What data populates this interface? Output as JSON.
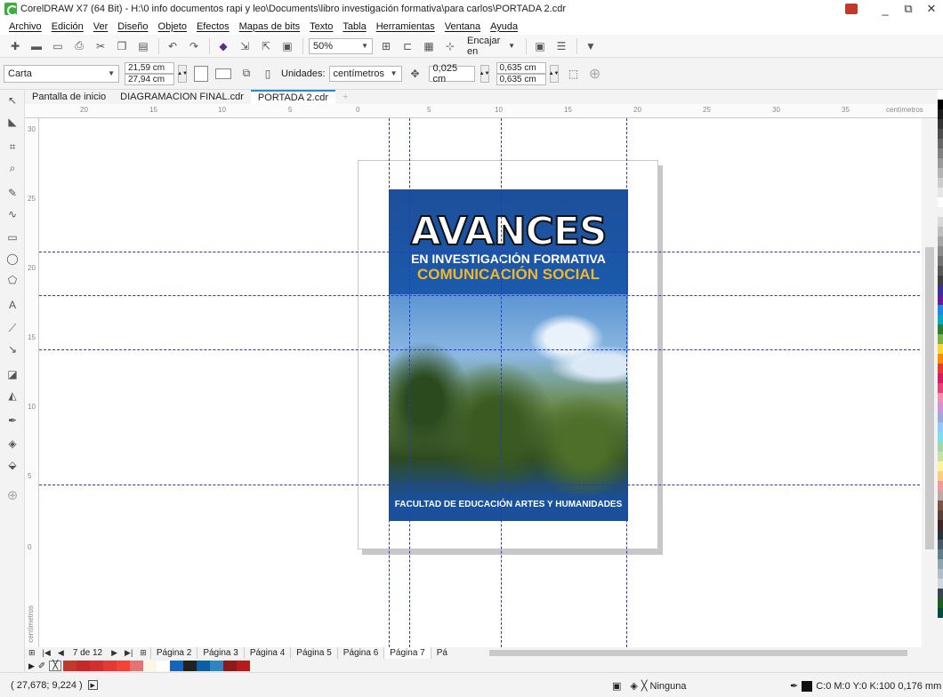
{
  "window": {
    "title": "CorelDRAW X7 (64 Bit) - H:\\0 info documentos rapi y leo\\Documents\\libro investigación formativa\\para carlos\\PORTADA 2.cdr",
    "controls": [
      "_",
      "⧉",
      "✕"
    ]
  },
  "menu": [
    "Archivo",
    "Edición",
    "Ver",
    "Diseño",
    "Objeto",
    "Efectos",
    "Mapas de bits",
    "Texto",
    "Tabla",
    "Herramientas",
    "Ventana",
    "Ayuda"
  ],
  "toolbar": {
    "zoom": "50%",
    "snap_label": "Encajar en",
    "icons": [
      "new-icon",
      "open-icon",
      "save-icon",
      "print-icon",
      "cut-icon",
      "copy-icon",
      "paste-icon",
      "undo-icon",
      "redo-icon",
      "search-content-icon",
      "import-icon",
      "export-icon",
      "publish-pdf-icon"
    ]
  },
  "propbar": {
    "paper": "Carta",
    "width": "21,59 cm",
    "height": "27,94 cm",
    "units_label": "Unidades:",
    "units": "centímetros",
    "nudge": "0,025 cm",
    "dup_x": "0,635 cm",
    "dup_y": "0,635 cm"
  },
  "doc_tabs": [
    "Pantalla de inicio",
    "DIAGRAMACION FINAL.cdr",
    "PORTADA 2.cdr"
  ],
  "ruler": {
    "h_ticks": [
      "20",
      "15",
      "10",
      "5",
      "0",
      "5",
      "10",
      "15",
      "20",
      "25",
      "30",
      "35"
    ],
    "h_unit": "centímetros",
    "v_ticks": [
      "30",
      "25",
      "20",
      "15",
      "10",
      "5",
      "0"
    ],
    "v_unit": "centímetros"
  },
  "cover": {
    "title": "AVANCES",
    "subtitle1": "EN INVESTIGACIÓN FORMATIVA",
    "subtitle2": "COMUNICACIÓN SOCIAL",
    "footer": "FACULTAD DE EDUCACIÓN ARTES Y HUMANIDADES"
  },
  "page_nav": {
    "counter": "7 de 12",
    "pages": [
      "Página 2",
      "Página 3",
      "Página 4",
      "Página 5",
      "Página 6",
      "Página 7",
      "Pá"
    ],
    "active": "Página 7"
  },
  "status": {
    "coords": "( 27,678; 9,224 )",
    "fill": "Ninguna",
    "outline": "C:0 M:0 Y:0 K:100  0,176 mm"
  },
  "palette_colors": [
    "#ffffff",
    "#000000",
    "#1a1a1a",
    "#333333",
    "#4d4d4d",
    "#666666",
    "#808080",
    "#999999",
    "#b3b3b3",
    "#cccccc",
    "#e6e6e6",
    "#ffffff",
    "#f2f2f2",
    "#d9d9d9",
    "#bfbfbf",
    "#a6a6a6",
    "#8c8c8c",
    "#737373",
    "#595959",
    "#404040",
    "#3b2f9e",
    "#6a1b9a",
    "#1e88e5",
    "#00acc1",
    "#2e7d32",
    "#7cb342",
    "#fdd835",
    "#fb8c00",
    "#e53935",
    "#d81b60",
    "#ec407a",
    "#f48fb1",
    "#ce93d8",
    "#9fa8da",
    "#90caf9",
    "#80deea",
    "#a5d6a7",
    "#c5e1a5",
    "#fff59d",
    "#ffcc80",
    "#ef9a9a",
    "#bcaaa4",
    "#795548",
    "#5d4037",
    "#3e2723",
    "#263238",
    "#455a64",
    "#607d8b",
    "#90a4ae",
    "#b0bec5",
    "#cfd8dc",
    "#37474f",
    "#1b5e20",
    "#004d40"
  ],
  "doc_palette": [
    "#c0392b",
    "#c62828",
    "#d32f2f",
    "#e53935",
    "#f44336",
    "#e57373",
    "#fdf5e6",
    "#ffffff",
    "#1565c0",
    "#222222",
    "#0b5fa5",
    "#2e86c1",
    "#8e1b1b",
    "#b71c1c"
  ]
}
